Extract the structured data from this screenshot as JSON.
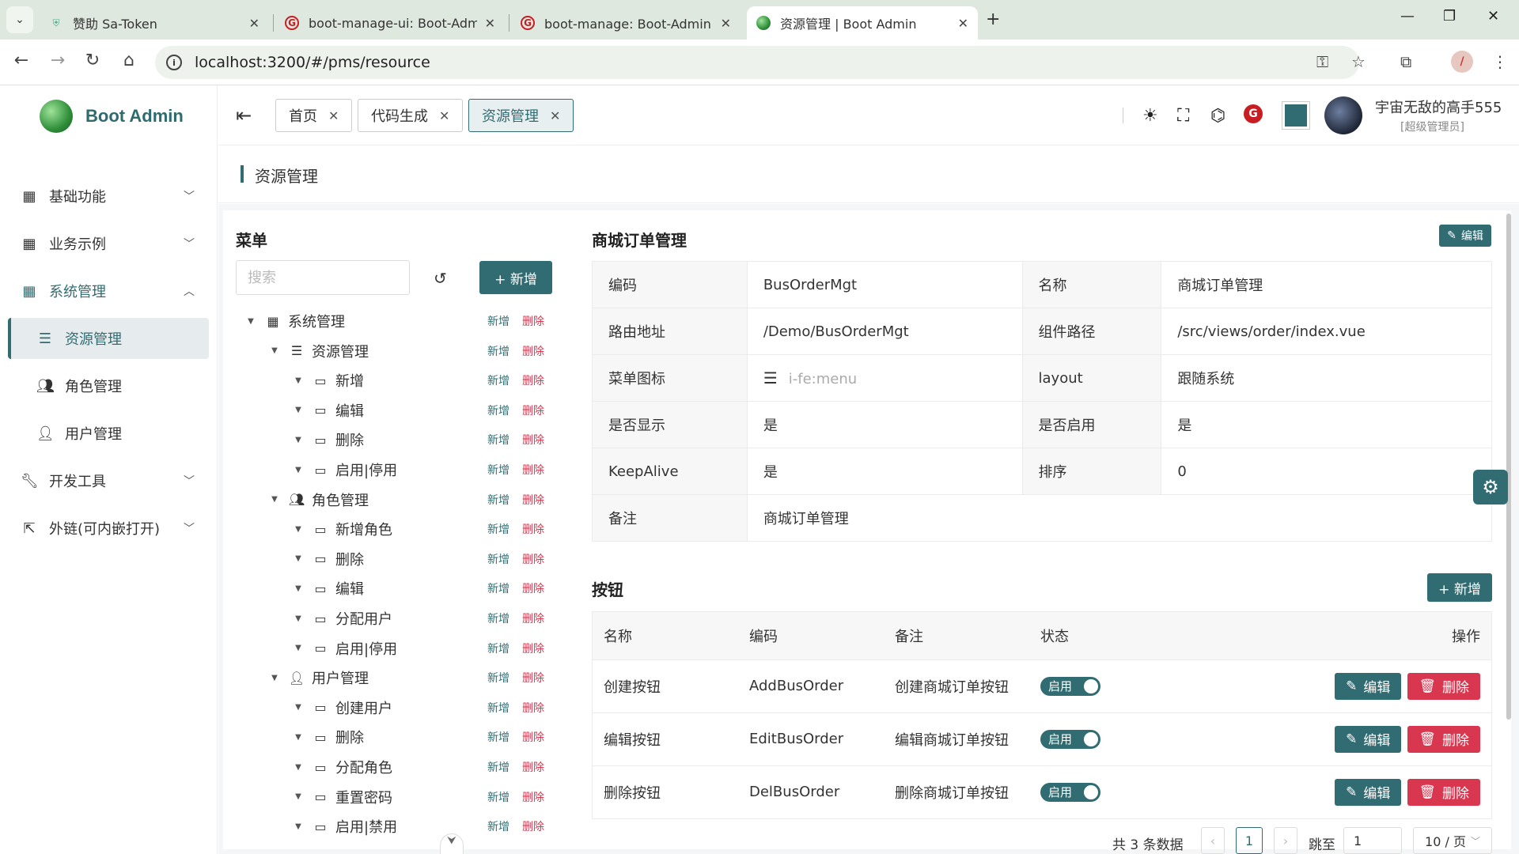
{
  "browser": {
    "tabs": [
      {
        "title": "赞助 Sa-Token"
      },
      {
        "title": "boot-manage-ui: Boot-Admi"
      },
      {
        "title": "boot-manage: Boot-Admin 后"
      },
      {
        "title": "资源管理 | Boot Admin"
      }
    ],
    "url": "localhost:3200/#/pms/resource"
  },
  "app": {
    "name": "Boot Admin"
  },
  "sidebar": {
    "items": [
      {
        "label": "基础功能",
        "icon": "grid-icon"
      },
      {
        "label": "业务示例",
        "icon": "grid-icon"
      },
      {
        "label": "系统管理",
        "icon": "grid-icon"
      },
      {
        "label": "资源管理",
        "icon": "list-icon"
      },
      {
        "label": "角色管理",
        "icon": "user-check-icon"
      },
      {
        "label": "用户管理",
        "icon": "user-icon"
      },
      {
        "label": "开发工具",
        "icon": "wrench-icon"
      },
      {
        "label": "外链(可内嵌打开)",
        "icon": "external-link-icon"
      }
    ]
  },
  "header": {
    "tabs": [
      {
        "label": "首页"
      },
      {
        "label": "代码生成"
      },
      {
        "label": "资源管理"
      }
    ],
    "user_name": "宇宙无敌的高手555",
    "user_role": "[超级管理员]",
    "theme_color": "#316c72"
  },
  "page": {
    "title": "资源管理"
  },
  "tree": {
    "title": "菜单",
    "search_placeholder": "搜索",
    "add_label": "+ 新增",
    "action_add": "新增",
    "action_del": "删除",
    "nodes": [
      {
        "label": "系统管理",
        "icon": "grid-icon",
        "level": 0
      },
      {
        "label": "资源管理",
        "icon": "list-icon",
        "level": 1
      },
      {
        "label": "新增",
        "icon": "button-icon",
        "level": 2
      },
      {
        "label": "编辑",
        "icon": "button-icon",
        "level": 2
      },
      {
        "label": "删除",
        "icon": "button-icon",
        "level": 2
      },
      {
        "label": "启用|停用",
        "icon": "button-icon",
        "level": 2
      },
      {
        "label": "角色管理",
        "icon": "user-check-icon",
        "level": 1
      },
      {
        "label": "新增角色",
        "icon": "button-icon",
        "level": 2
      },
      {
        "label": "删除",
        "icon": "button-icon",
        "level": 2
      },
      {
        "label": "编辑",
        "icon": "button-icon",
        "level": 2
      },
      {
        "label": "分配用户",
        "icon": "button-icon",
        "level": 2
      },
      {
        "label": "启用|停用",
        "icon": "button-icon",
        "level": 2
      },
      {
        "label": "用户管理",
        "icon": "user-icon",
        "level": 1
      },
      {
        "label": "创建用户",
        "icon": "button-icon",
        "level": 2
      },
      {
        "label": "删除",
        "icon": "button-icon",
        "level": 2
      },
      {
        "label": "分配角色",
        "icon": "button-icon",
        "level": 2
      },
      {
        "label": "重置密码",
        "icon": "button-icon",
        "level": 2
      },
      {
        "label": "启用|禁用",
        "icon": "button-icon",
        "level": 2
      }
    ]
  },
  "detail": {
    "title": "商城订单管理",
    "edit_label": "编辑",
    "rows": [
      {
        "l1": "编码",
        "v1": "BusOrderMgt",
        "l2": "名称",
        "v2": "商城订单管理"
      },
      {
        "l1": "路由地址",
        "v1": "/Demo/BusOrderMgt",
        "l2": "组件路径",
        "v2": "/src/views/order/index.vue"
      },
      {
        "l1": "菜单图标",
        "v1": "i-fe:menu",
        "l2": "layout",
        "v2": "跟随系统"
      },
      {
        "l1": "是否显示",
        "v1": "是",
        "l2": "是否启用",
        "v2": "是"
      },
      {
        "l1": "KeepAlive",
        "v1": "是",
        "l2": "排序",
        "v2": "0"
      }
    ],
    "remark_label": "备注",
    "remark_value": "商城订单管理"
  },
  "buttons": {
    "title": "按钮",
    "add_label": "+ 新增",
    "columns": [
      "名称",
      "编码",
      "备注",
      "状态",
      "操作"
    ],
    "rows": [
      {
        "name": "创建按钮",
        "code": "AddBusOrder",
        "remark": "创建商城订单按钮",
        "status": "启用"
      },
      {
        "name": "编辑按钮",
        "code": "EditBusOrder",
        "remark": "编辑商城订单按钮",
        "status": "启用"
      },
      {
        "name": "删除按钮",
        "code": "DelBusOrder",
        "remark": "删除商城订单按钮",
        "status": "启用"
      }
    ],
    "edit_label": "编辑",
    "delete_label": "删除"
  },
  "pagination": {
    "total_text": "共 3 条数据",
    "current_page": "1",
    "jump_label": "跳至",
    "jump_value": "1",
    "page_size": "10 / 页"
  }
}
